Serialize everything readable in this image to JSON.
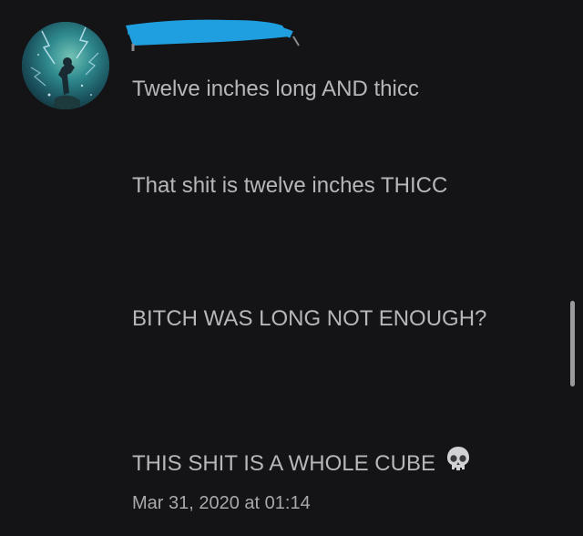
{
  "messages": [
    {
      "text": "Twelve inches long AND thicc"
    },
    {
      "text": "That shit is twelve inches THICC"
    },
    {
      "text": "BITCH WAS LONG NOT ENOUGH?"
    },
    {
      "text": "THIS SHIT IS A WHOLE CUBE",
      "emoji": "skull-icon"
    }
  ],
  "timestamp": "Mar 31, 2020 at 01:14",
  "colors": {
    "background": "#141416",
    "text": "#b7b7bb",
    "redaction": "#1f9fe0"
  }
}
